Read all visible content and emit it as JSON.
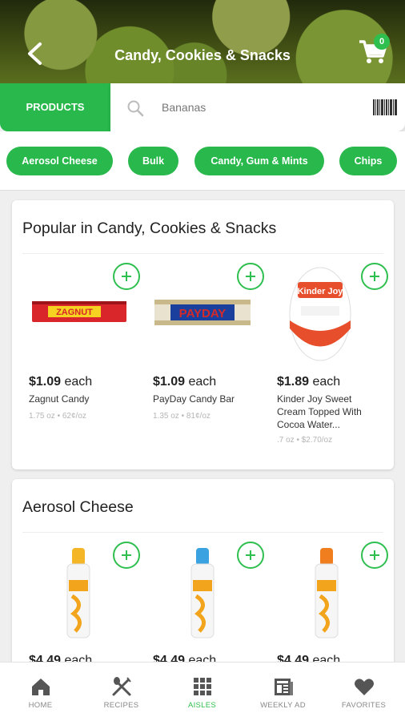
{
  "header": {
    "title": "Candy, Cookies & Snacks",
    "cart_count": "0"
  },
  "search": {
    "tab_label": "PRODUCTS",
    "placeholder": "Bananas"
  },
  "chips": [
    "Aerosol Cheese",
    "Bulk",
    "Candy, Gum & Mints",
    "Chips"
  ],
  "sections": [
    {
      "title": "Popular in Candy, Cookies & Snacks",
      "products": [
        {
          "price": "$1.09",
          "unit": "each",
          "name": "Zagnut Candy",
          "size": "1.75 oz • 62¢/oz",
          "image_text": "ZAGNUT",
          "image_color": "#d8262a"
        },
        {
          "price": "$1.09",
          "unit": "each",
          "name": "PayDay Candy Bar",
          "size": "1.35 oz • 81¢/oz",
          "image_text": "PAYDAY",
          "image_color": "#d42a2a"
        },
        {
          "price": "$1.89",
          "unit": "each",
          "name": "Kinder Joy Sweet Cream Topped With Cocoa Water...",
          "size": ".7 oz • $2.70/oz",
          "image_text": "Kinder Joy",
          "image_color": "#e74e2b"
        }
      ]
    },
    {
      "title": "Aerosol Cheese",
      "products": [
        {
          "price": "$4.49",
          "unit": "each",
          "image_color": "#f4b627"
        },
        {
          "price": "$4.49",
          "unit": "each",
          "image_color": "#3aa2e0"
        },
        {
          "price": "$4.49",
          "unit": "each",
          "image_color": "#f07d1e"
        }
      ]
    }
  ],
  "nav": [
    {
      "label": "HOME",
      "icon": "home-icon"
    },
    {
      "label": "RECIPES",
      "icon": "recipes-icon"
    },
    {
      "label": "AISLES",
      "icon": "aisles-icon",
      "active": true
    },
    {
      "label": "WEEKLY AD",
      "icon": "weekly-ad-icon"
    },
    {
      "label": "FAVORITES",
      "icon": "favorites-icon"
    }
  ],
  "colors": {
    "accent": "#28b84c",
    "badge": "#2fbf4f"
  }
}
